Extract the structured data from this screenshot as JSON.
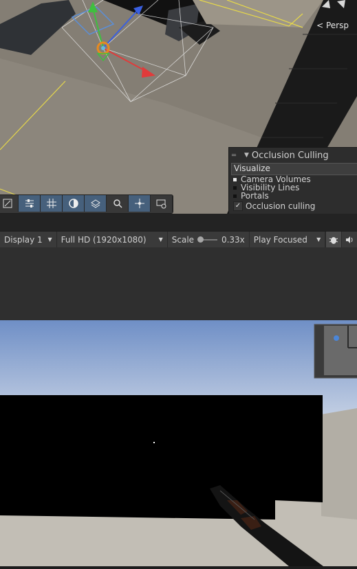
{
  "scene_view": {
    "projection_label": "< Persp",
    "toolbar_icons": [
      "gizmo-toggle-icon",
      "sliders-icon",
      "grid-icon",
      "lighting-icon",
      "layers-icon",
      "search-icon",
      "move-tool-icon",
      "camera-eye-icon"
    ]
  },
  "occlusion_panel": {
    "title": "Occlusion Culling",
    "visualize_label": "Visualize",
    "options": [
      {
        "label": "Camera Volumes",
        "checked": true
      },
      {
        "label": "Visibility Lines",
        "checked": false
      },
      {
        "label": "Portals",
        "checked": false
      }
    ],
    "occlusion_toggle_label": "Occlusion culling",
    "occlusion_toggle_checked": true
  },
  "game_toolbar": {
    "display_label": "Display 1",
    "resolution_label": "Full HD (1920x1080)",
    "scale_label": "Scale",
    "scale_value": "0.33x",
    "play_mode_label": "Play Focused"
  },
  "colors": {
    "accent_blue": "#46607c",
    "sky_top": "#6f8fc6",
    "sky_bottom": "#c3cfe3"
  }
}
